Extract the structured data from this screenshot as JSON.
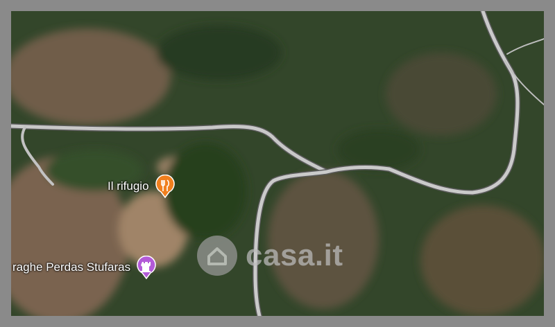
{
  "map": {
    "style": "satellite",
    "pois": [
      {
        "label": "Il rifugio",
        "icon": "restaurant-icon",
        "color": "#f07f1e"
      },
      {
        "label": "raghe Perdas Stufaras",
        "icon": "castle-icon",
        "color": "#b35ad8"
      }
    ],
    "watermark": {
      "text": "casa.it",
      "icon": "house-logo-icon"
    }
  },
  "colors": {
    "frame": "#8a8a8a",
    "road": "#c8c8c8",
    "forest": "#2f4526",
    "clearing": "#a28466"
  }
}
